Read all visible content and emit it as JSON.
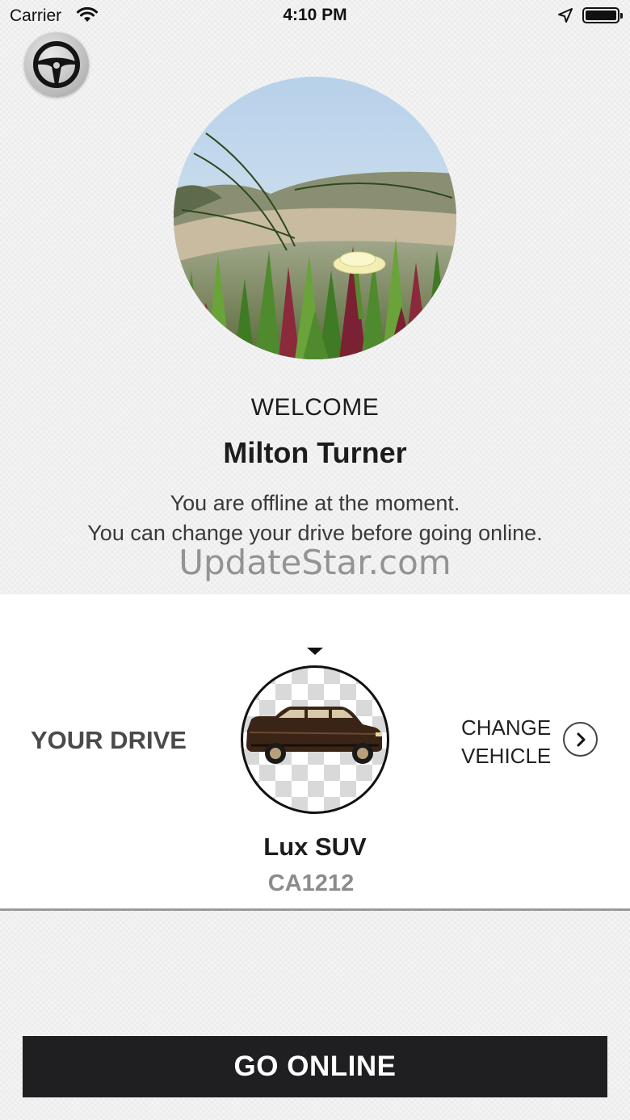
{
  "status_bar": {
    "carrier": "Carrier",
    "time": "4:10 PM"
  },
  "header": {
    "menu_icon": "steering-wheel-icon"
  },
  "profile": {
    "welcome": "WELCOME",
    "name": "Milton Turner",
    "message_line1": "You are offline at the moment.",
    "message_line2": "You can change your drive before going online."
  },
  "watermark": "UpdateStar.com",
  "drive": {
    "section_label": "YOUR DRIVE",
    "change_label_line1": "CHANGE",
    "change_label_line2": "VEHICLE",
    "vehicle_name": "Lux SUV",
    "plate": "CA1212"
  },
  "actions": {
    "go_online": "GO ONLINE"
  },
  "colors": {
    "button_bg": "#1f1f22",
    "panel_bg": "#ffffff",
    "page_bg": "#f4f4f4"
  }
}
